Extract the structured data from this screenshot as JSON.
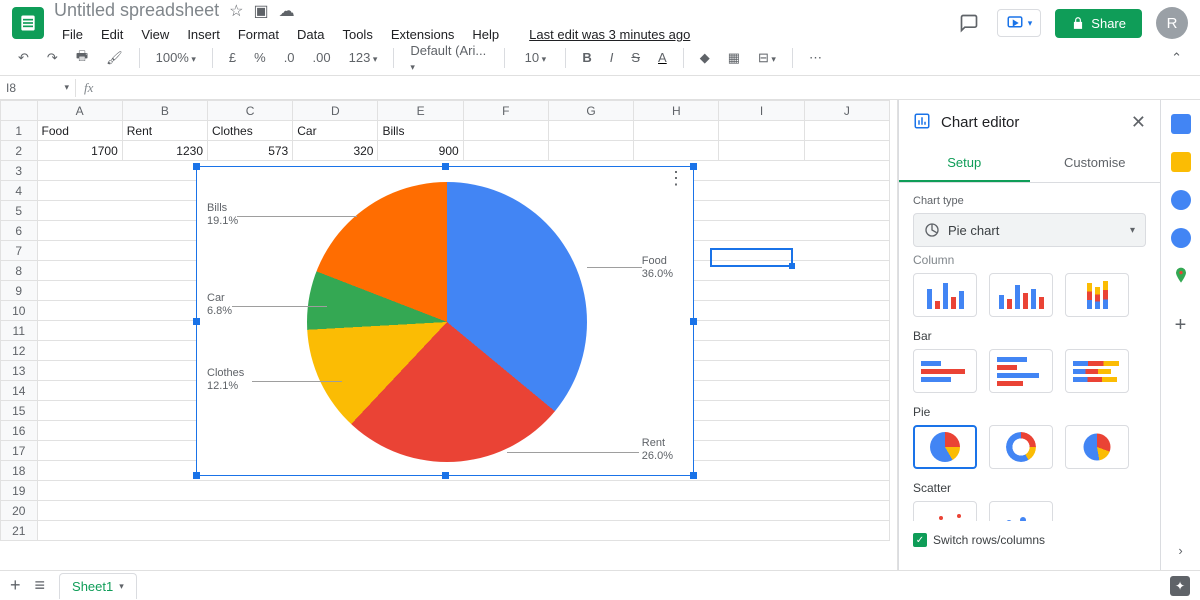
{
  "doc": {
    "title": "Untitled spreadsheet",
    "last_edit": "Last edit was 3 minutes ago"
  },
  "menu": {
    "file": "File",
    "edit": "Edit",
    "view": "View",
    "insert": "Insert",
    "format": "Format",
    "data": "Data",
    "tools": "Tools",
    "extensions": "Extensions",
    "help": "Help"
  },
  "share": {
    "label": "Share"
  },
  "avatar": {
    "initial": "R"
  },
  "toolbar": {
    "zoom": "100%",
    "currency": "£",
    "pct": "%",
    "dec_dec": ".0",
    "dec_inc": ".00",
    "num_fmt": "123",
    "font": "Default (Ari...",
    "size": "10"
  },
  "name_box": "I8",
  "columns": [
    "A",
    "B",
    "C",
    "D",
    "E",
    "F",
    "G",
    "H",
    "I",
    "J"
  ],
  "row1": {
    "A": "Food",
    "B": "Rent",
    "C": "Clothes",
    "D": "Car",
    "E": "Bills"
  },
  "row2": {
    "A": "1700",
    "B": "1230",
    "C": "573",
    "D": "320",
    "E": "900"
  },
  "chart_labels": {
    "food": "Food",
    "food_pct": "36.0%",
    "rent": "Rent",
    "rent_pct": "26.0%",
    "clothes": "Clothes",
    "clothes_pct": "12.1%",
    "car": "Car",
    "car_pct": "6.8%",
    "bills": "Bills",
    "bills_pct": "19.1%"
  },
  "editor": {
    "title": "Chart editor",
    "tab_setup": "Setup",
    "tab_custom": "Customise",
    "chart_type_label": "Chart type",
    "chart_type_value": "Pie chart",
    "group_column": "Column",
    "group_bar": "Bar",
    "group_pie": "Pie",
    "group_scatter": "Scatter",
    "switch": "Switch rows/columns"
  },
  "sheet": {
    "name": "Sheet1"
  },
  "chart_data": {
    "type": "pie",
    "title": "",
    "categories": [
      "Food",
      "Rent",
      "Clothes",
      "Car",
      "Bills"
    ],
    "values": [
      1700,
      1230,
      573,
      320,
      900
    ],
    "percentages": [
      36.0,
      26.0,
      12.1,
      6.8,
      19.1
    ],
    "colors": [
      "#4285f4",
      "#ea4335",
      "#fbbc04",
      "#34a853",
      "#ff6d01"
    ]
  }
}
